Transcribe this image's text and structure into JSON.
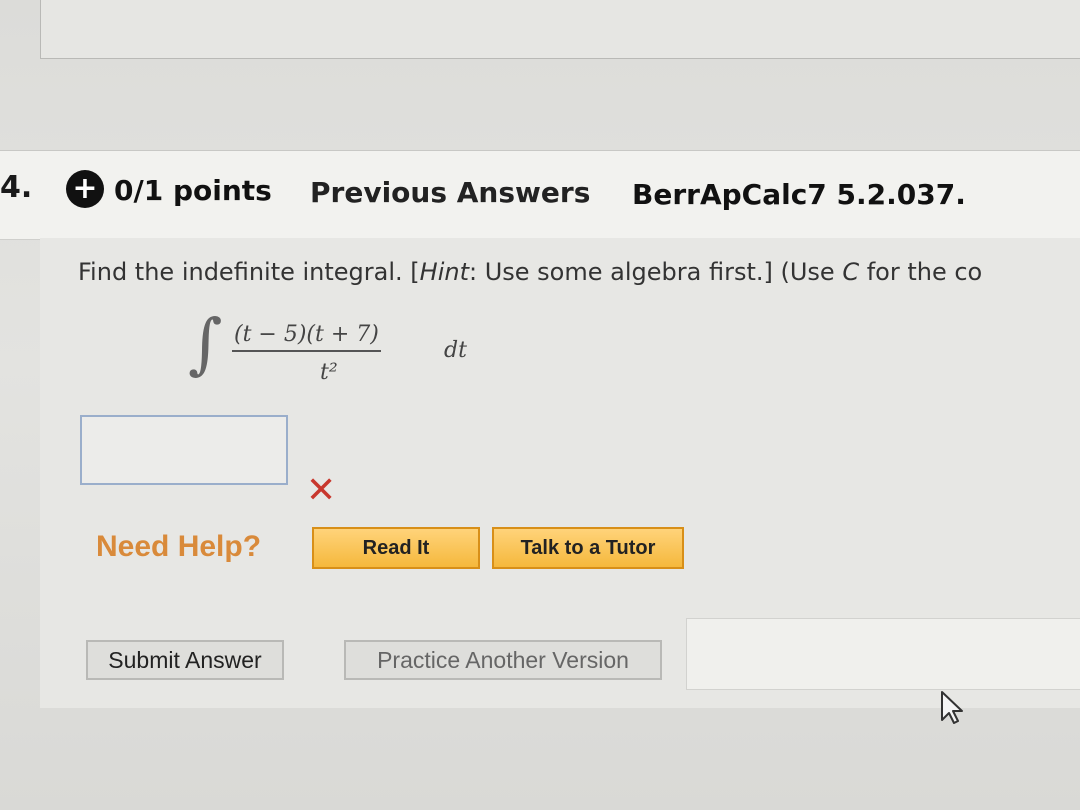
{
  "question": {
    "number": "4.",
    "points": "0/1 points",
    "previous_answers": "Previous Answers",
    "code": "BerrApCalc7 5.2.037.",
    "prompt_start": "Find the indefinite integral. [",
    "hint_label": "Hint",
    "prompt_middle": ": Use some algebra first.] (Use ",
    "var_c": "C",
    "prompt_end": " for the co"
  },
  "integral": {
    "sign": "∫",
    "numerator": "(t − 5)(t + 7)",
    "denominator": "t²",
    "differential": "dt"
  },
  "answer": {
    "value": "",
    "status_icon": "wrong-x-icon",
    "status_glyph": "✕"
  },
  "help": {
    "label": "Need Help?",
    "read_it": "Read It",
    "talk_tutor": "Talk to a Tutor"
  },
  "actions": {
    "submit": "Submit Answer",
    "practice": "Practice Another Version"
  },
  "colors": {
    "error": "#c8372d",
    "help": "#d98a3a",
    "help_button": "#f5b83c"
  }
}
